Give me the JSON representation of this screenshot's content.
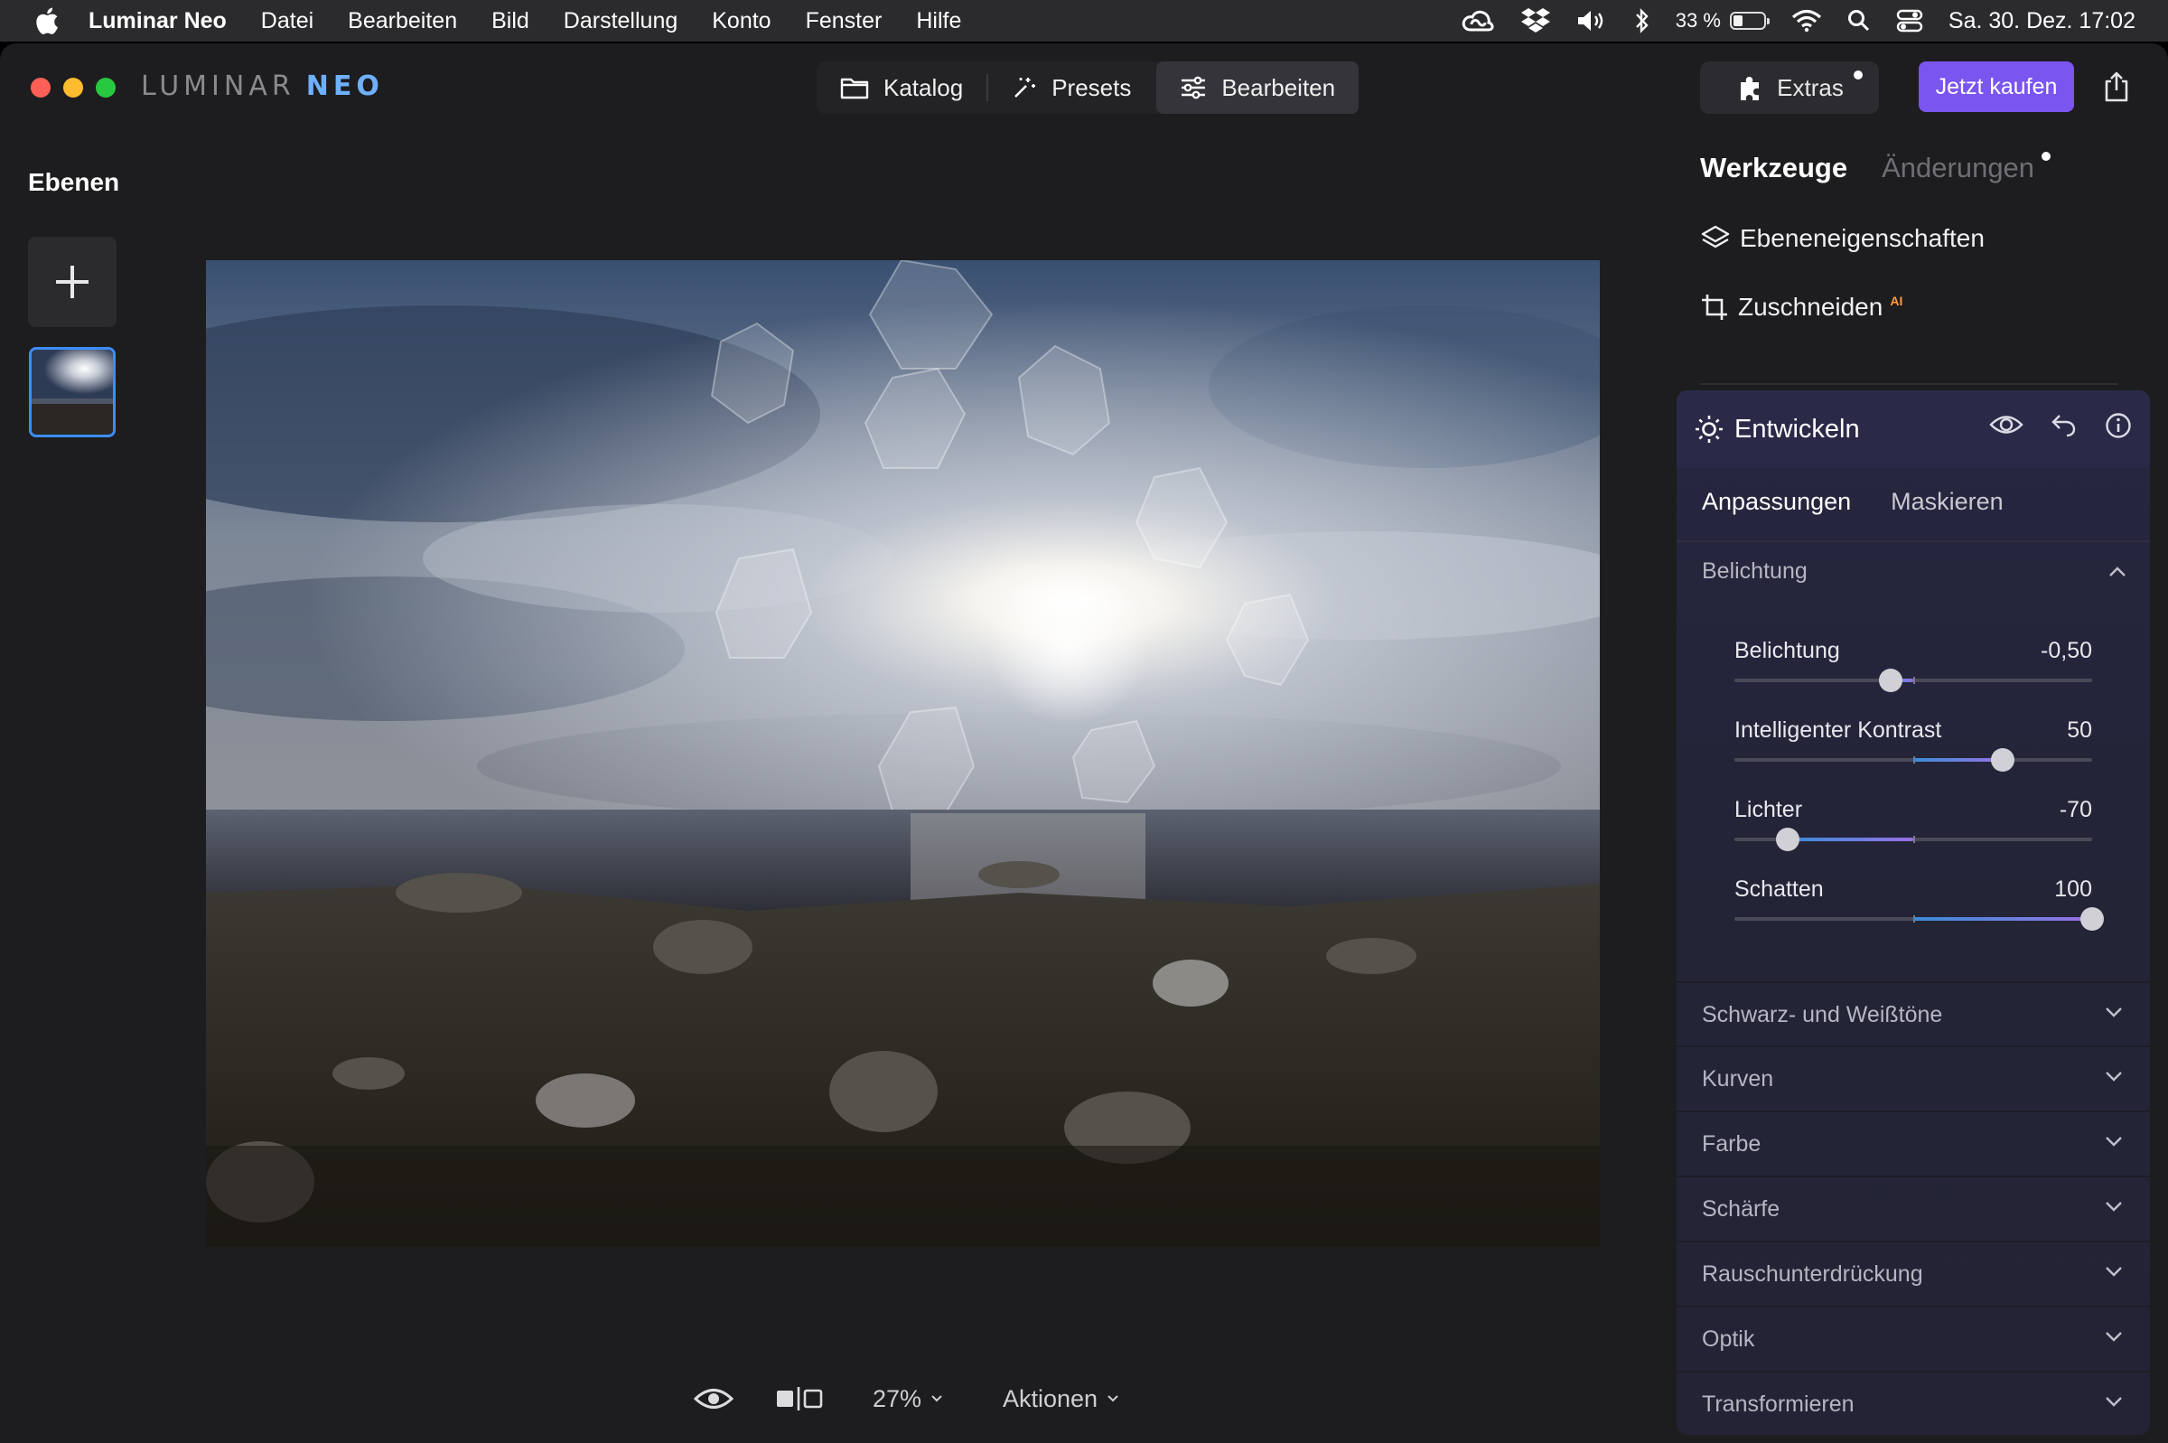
{
  "menubar": {
    "app_name": "Luminar Neo",
    "items": [
      "Datei",
      "Bearbeiten",
      "Bild",
      "Darstellung",
      "Konto",
      "Fenster",
      "Hilfe"
    ],
    "battery_percent": "33 %",
    "battery_level": 0.33,
    "clock": "Sa. 30. Dez.  17:02"
  },
  "window": {
    "logo_part1": "LUMINAR",
    "logo_part2": "NEO",
    "modes": {
      "catalog": "Katalog",
      "presets": "Presets",
      "edit": "Bearbeiten"
    },
    "extras_label": "Extras",
    "buy_label": "Jetzt kaufen"
  },
  "layers": {
    "title": "Ebenen"
  },
  "bottom": {
    "zoom": "27%",
    "actions": "Aktionen"
  },
  "panel": {
    "tab_tools": "Werkzeuge",
    "tab_changes": "Änderungen",
    "tool_layer_props": "Ebeneneigenschaften",
    "tool_crop": "Zuschneiden",
    "tool_crop_badge": "AI",
    "develop": {
      "title": "Entwickeln",
      "subtab_adjust": "Anpassungen",
      "subtab_mask": "Maskieren",
      "section_exposure": "Belichtung",
      "sliders": [
        {
          "label": "Belichtung",
          "value": "-0,50",
          "num": -0.5,
          "min": -4,
          "max": 4
        },
        {
          "label": "Intelligenter Kontrast",
          "value": "50",
          "num": 50,
          "min": -100,
          "max": 100
        },
        {
          "label": "Lichter",
          "value": "-70",
          "num": -70,
          "min": -100,
          "max": 100
        },
        {
          "label": "Schatten",
          "value": "100",
          "num": 100,
          "min": -100,
          "max": 100
        }
      ],
      "sections": [
        "Schwarz- und Weißtöne",
        "Kurven",
        "Farbe",
        "Schärfe",
        "Rauschunterdrückung",
        "Optik",
        "Transformieren"
      ]
    }
  },
  "colors": {
    "accent": "#7a55f0",
    "selection": "#3d8cff",
    "close": "#ff5f57",
    "minimize": "#febc2e",
    "zoom": "#28c840"
  }
}
